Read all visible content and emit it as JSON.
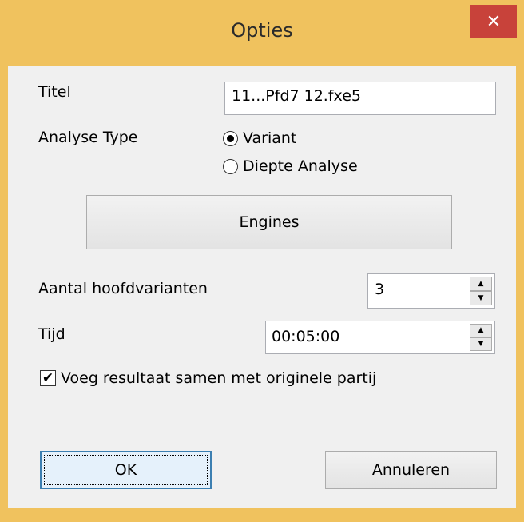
{
  "window": {
    "title": "Opties",
    "close_glyph": "✕"
  },
  "form": {
    "titel_label": "Titel",
    "titel_value": "11...Pfd7 12.fxe5",
    "analyse_label": "Analyse Type",
    "radio_options": [
      {
        "label": "Variant",
        "checked": true
      },
      {
        "label": "Diepte Analyse",
        "checked": false
      }
    ],
    "engines_button": "Engines",
    "hoofdvarianten_label": "Aantal hoofdvarianten",
    "hoofdvarianten_value": "3",
    "tijd_label": "Tijd",
    "tijd_value": "00:05:00",
    "merge_checkbox_label": "Voeg resultaat samen met originele partij",
    "merge_checked": true
  },
  "buttons": {
    "ok_accel": "O",
    "ok_rest": "K",
    "cancel_accel": "A",
    "cancel_rest": "nnuleren"
  },
  "icons": {
    "spin_up": "▲",
    "spin_down": "▼",
    "checkmark": "✔"
  },
  "colors": {
    "titlebar": "#f0c25e",
    "close": "#c8423a",
    "client": "#f0f0f0"
  }
}
